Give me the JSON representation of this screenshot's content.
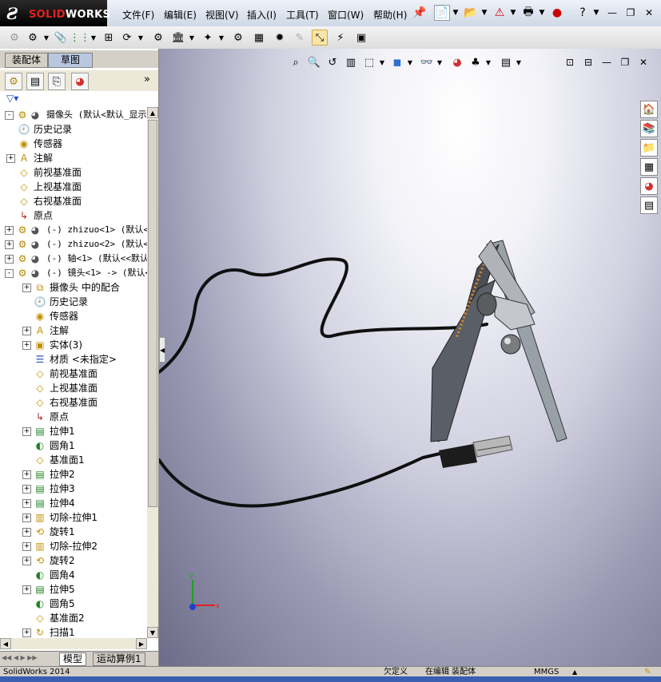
{
  "app": {
    "brand_ds": "Ƨ",
    "brand_name": "SOLIDWORKS"
  },
  "menu": [
    {
      "label": "文件(F)"
    },
    {
      "label": "编辑(E)"
    },
    {
      "label": "视图(V)"
    },
    {
      "label": "插入(I)"
    },
    {
      "label": "工具(T)"
    },
    {
      "label": "窗口(W)"
    },
    {
      "label": "帮助(H)"
    }
  ],
  "window_controls": {
    "minimize": "—",
    "restore": "❐",
    "close": "✕"
  },
  "panel_tabs": {
    "assembly": "装配体",
    "sketch": "草图"
  },
  "tree": {
    "rows": [
      {
        "level": 0,
        "exp": "-",
        "icon": "assembly-icon",
        "glyph": "⚙",
        "label": "摄像头  (默认<默认_显示状"
      },
      {
        "level": 1,
        "exp": "",
        "icon": "history-icon",
        "glyph": "🕘",
        "label": "历史记录"
      },
      {
        "level": 1,
        "exp": "",
        "icon": "sensor-icon",
        "glyph": "◉",
        "label": "传感器"
      },
      {
        "level": 1,
        "exp": "+",
        "icon": "annotation-icon",
        "glyph": "A",
        "label": "注解"
      },
      {
        "level": 1,
        "exp": "",
        "icon": "plane-icon",
        "glyph": "◇",
        "label": "前视基准面"
      },
      {
        "level": 1,
        "exp": "",
        "icon": "plane-icon",
        "glyph": "◇",
        "label": "上视基准面"
      },
      {
        "level": 1,
        "exp": "",
        "icon": "plane-icon",
        "glyph": "◇",
        "label": "右视基准面"
      },
      {
        "level": 1,
        "exp": "",
        "icon": "origin-icon",
        "glyph": "↳",
        "label": "原点"
      },
      {
        "level": 0,
        "exp": "+",
        "icon": "part-icon",
        "glyph": "⚙",
        "label": "(-) zhizuo<1> (默认<"
      },
      {
        "level": 0,
        "exp": "+",
        "icon": "part-icon",
        "glyph": "⚙",
        "label": "(-) zhizuo<2> (默认<"
      },
      {
        "level": 0,
        "exp": "+",
        "icon": "part-icon",
        "glyph": "⚙",
        "label": "(-) 轴<1> (默认<<默认"
      },
      {
        "level": 0,
        "exp": "-",
        "icon": "part-icon",
        "glyph": "⚙",
        "label": "(-) 镜头<1> -> (默认<"
      },
      {
        "level": 2,
        "exp": "+",
        "icon": "mate-icon",
        "glyph": "⧉",
        "label": "摄像头 中的配合"
      },
      {
        "level": 2,
        "exp": "",
        "icon": "history-icon",
        "glyph": "🕘",
        "label": "历史记录"
      },
      {
        "level": 2,
        "exp": "",
        "icon": "sensor-icon",
        "glyph": "◉",
        "label": "传感器"
      },
      {
        "level": 2,
        "exp": "+",
        "icon": "annotation-icon",
        "glyph": "A",
        "label": "注解"
      },
      {
        "level": 2,
        "exp": "+",
        "icon": "solid-body-icon",
        "glyph": "▣",
        "label": "实体(3)"
      },
      {
        "level": 2,
        "exp": "",
        "icon": "material-icon",
        "glyph": "☰",
        "label": "材质 <未指定>"
      },
      {
        "level": 2,
        "exp": "",
        "icon": "plane-icon",
        "glyph": "◇",
        "label": "前视基准面"
      },
      {
        "level": 2,
        "exp": "",
        "icon": "plane-icon",
        "glyph": "◇",
        "label": "上视基准面"
      },
      {
        "level": 2,
        "exp": "",
        "icon": "plane-icon",
        "glyph": "◇",
        "label": "右视基准面"
      },
      {
        "level": 2,
        "exp": "",
        "icon": "origin-icon",
        "glyph": "↳",
        "label": "原点"
      },
      {
        "level": 2,
        "exp": "+",
        "icon": "extrude-icon",
        "glyph": "▤",
        "label": "拉伸1"
      },
      {
        "level": 2,
        "exp": "",
        "icon": "fillet-icon",
        "glyph": "◐",
        "label": "圆角1"
      },
      {
        "level": 2,
        "exp": "",
        "icon": "plane-icon",
        "glyph": "◇",
        "label": "基准面1"
      },
      {
        "level": 2,
        "exp": "+",
        "icon": "extrude-icon",
        "glyph": "▤",
        "label": "拉伸2"
      },
      {
        "level": 2,
        "exp": "+",
        "icon": "extrude-icon",
        "glyph": "▤",
        "label": "拉伸3"
      },
      {
        "level": 2,
        "exp": "+",
        "icon": "extrude-icon",
        "glyph": "▤",
        "label": "拉伸4"
      },
      {
        "level": 2,
        "exp": "+",
        "icon": "cut-extrude-icon",
        "glyph": "▥",
        "label": "切除-拉伸1"
      },
      {
        "level": 2,
        "exp": "+",
        "icon": "revolve-icon",
        "glyph": "⟲",
        "label": "旋转1"
      },
      {
        "level": 2,
        "exp": "+",
        "icon": "cut-extrude-icon",
        "glyph": "▥",
        "label": "切除-拉伸2"
      },
      {
        "level": 2,
        "exp": "+",
        "icon": "revolve-icon",
        "glyph": "⟲",
        "label": "旋转2"
      },
      {
        "level": 2,
        "exp": "",
        "icon": "fillet-icon",
        "glyph": "◐",
        "label": "圆角4"
      },
      {
        "level": 2,
        "exp": "+",
        "icon": "extrude-icon",
        "glyph": "▤",
        "label": "拉伸5"
      },
      {
        "level": 2,
        "exp": "",
        "icon": "fillet-icon",
        "glyph": "◐",
        "label": "圆角5"
      },
      {
        "level": 2,
        "exp": "",
        "icon": "plane-icon",
        "glyph": "◇",
        "label": "基准面2"
      },
      {
        "level": 2,
        "exp": "+",
        "icon": "sweep-icon",
        "glyph": "↻",
        "label": "扫描1"
      }
    ]
  },
  "bottom_tabs": {
    "model": "模型",
    "motion": "运动算例1"
  },
  "status": {
    "version": "SolidWorks 2014",
    "definition": "欠定义",
    "editing": "在编辑 装配体",
    "units": "MMGS"
  },
  "colors": {
    "viewport_light": "#ffffff",
    "viewport_dark": "#6c6c88",
    "accent": "#f8e6a8"
  }
}
